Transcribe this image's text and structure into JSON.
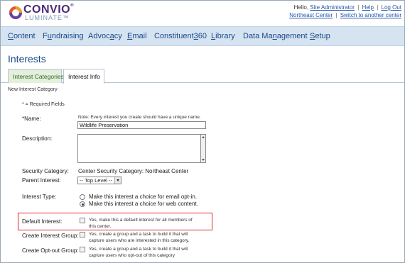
{
  "brand": {
    "name": "CONVIO",
    "reg": "®",
    "sub": "LUMINATE™"
  },
  "util": {
    "greeting": "Hello, ",
    "user": "Site Administrator",
    "help": "Help",
    "logout": "Log Out",
    "center": "Northeast Center",
    "switch": "Switch to another center",
    "sep": "|"
  },
  "nav": {
    "items": [
      {
        "pre": "",
        "ul": "C",
        "post": "ontent"
      },
      {
        "pre": "F",
        "ul": "u",
        "post": "ndraising"
      },
      {
        "pre": "Advoc",
        "ul": "a",
        "post": "cy"
      },
      {
        "pre": "",
        "ul": "E",
        "post": "mail"
      },
      {
        "pre": "Constituent",
        "ul": "3",
        "post": "60"
      },
      {
        "pre": "",
        "ul": "L",
        "post": "ibrary"
      },
      {
        "pre": "Data Ma",
        "ul": "n",
        "post": "agement"
      },
      {
        "pre": "",
        "ul": "S",
        "post": "etup"
      }
    ]
  },
  "page": {
    "title": "Interests"
  },
  "tabs": [
    {
      "label": "Interest Categories"
    },
    {
      "label": "Interest Info"
    }
  ],
  "form": {
    "section": "New Interest Category",
    "required_note": "* = Required Fields",
    "name_label": "*Name:",
    "name_note": "Note: Every interest you create should have a unique name.",
    "name_value": "Wildlife Preservation",
    "description_label": "Description:",
    "security_label": "Security Category:",
    "security_value": "Center Security Category: Northeast Center",
    "parent_label": "Parent Interest:",
    "parent_value": "-- Top Level --",
    "type_label": "Interest Type:",
    "type_option_1": "Make this interest a choice for email opt-in.",
    "type_option_2": "Make this interest a choice for web content.",
    "default_label": "Default Interest:",
    "default_text_1": "Yes, make this a default interest for all members of",
    "default_text_2": "this center.",
    "create_group_label": "Create Interest Group:",
    "create_group_text_1": "Yes, create a group and a task to build it that will",
    "create_group_text_2": "capture users who are interested in this category.",
    "optout_label": "Create Opt-out Group:",
    "optout_text_1": "Yes, create a group and a task to build it that will",
    "optout_text_2": "capture users who opt-out of this category"
  }
}
